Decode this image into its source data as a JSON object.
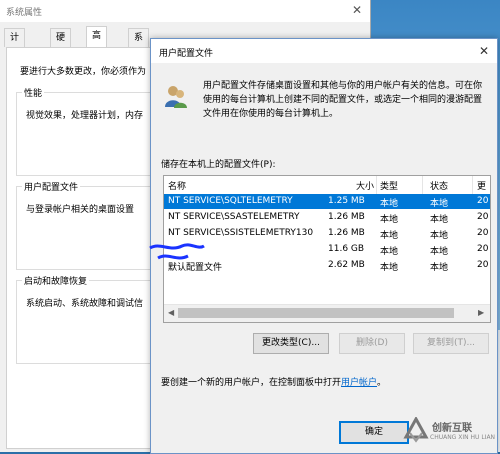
{
  "sysprops": {
    "title": "系统属性",
    "tabs": [
      "计算机名",
      "硬件",
      "高级",
      "系统保护"
    ],
    "intro": "要进行大多数更改，你必须作为",
    "performance": {
      "label": "性能",
      "text": "视觉效果，处理器计划，内存"
    },
    "profiles": {
      "label": "用户配置文件",
      "text": "与登录帐户相关的桌面设置"
    },
    "startup": {
      "label": "启动和故障恢复",
      "text": "系统启动、系统故障和调试信"
    }
  },
  "dialog": {
    "title": "用户配置文件",
    "description": "用户配置文件存储桌面设置和其他与你的用户帐户有关的信息。可在你使用的每台计算机上创建不同的配置文件，或选定一个相同的漫游配置文件用在你使用的每台计算机上。",
    "list_caption": "储存在本机上的配置文件(P):",
    "columns": [
      "名称",
      "大小",
      "类型",
      "状态",
      "更"
    ],
    "rows": [
      {
        "name": "NT SERVICE\\SQLTELEMETRY",
        "size": "1.25 MB",
        "type": "本地",
        "status": "本地",
        "more": "20",
        "selected": true
      },
      {
        "name": "NT SERVICE\\SSASTELEMETRY",
        "size": "1.26 MB",
        "type": "本地",
        "status": "本地",
        "more": "20",
        "selected": false
      },
      {
        "name": "NT SERVICE\\SSISTELEMETRY130",
        "size": "1.26 MB",
        "type": "本地",
        "status": "本地",
        "more": "20",
        "selected": false
      },
      {
        "name": "",
        "size": "11.6 GB",
        "type": "本地",
        "status": "本地",
        "more": "20",
        "selected": false
      },
      {
        "name": "默认配置文件",
        "size": "2.62 MB",
        "type": "本地",
        "status": "本地",
        "more": "20",
        "selected": false
      }
    ],
    "buttons": {
      "change_type": "更改类型(C)...",
      "delete": "删除(D)",
      "copy_to": "复制到(T)..."
    },
    "footer_prefix": "要创建一个新的用户帐户，在控制面板中打开",
    "footer_link": "用户帐户",
    "footer_suffix": "。",
    "ok": "确定"
  },
  "watermark": {
    "text": "创新互联",
    "sub": "CHUANG XIN HU LIAN"
  },
  "colors": {
    "selection": "#0078d7",
    "link": "#0066cc"
  }
}
